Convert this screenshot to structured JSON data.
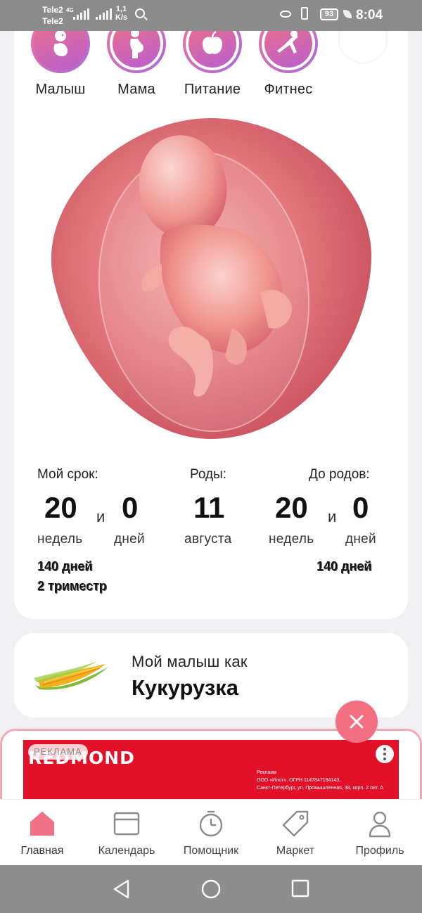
{
  "status_bar": {
    "carrier_1": "Tele2",
    "carrier_2": "Tele2",
    "network": "4G",
    "speed_value": "1,1",
    "speed_unit": "K/s",
    "battery": "93",
    "time": "8:04"
  },
  "categories": [
    {
      "label": "Малыш",
      "icon": "baby-icon"
    },
    {
      "label": "Мама",
      "icon": "pregnant-mother-icon"
    },
    {
      "label": "Питание",
      "icon": "apple-icon"
    },
    {
      "label": "Фитнес",
      "icon": "fitness-icon"
    },
    {
      "label": "",
      "icon": ""
    }
  ],
  "pregnancy": {
    "term_label": "Мой срок:",
    "term_weeks": "20",
    "term_days": "0",
    "and": "и",
    "weeks_unit": "недель",
    "days_unit": "дней",
    "birth_label": "Роды:",
    "birth_day": "11",
    "birth_month": "августа",
    "until_label": "До родов:",
    "until_weeks": "20",
    "until_days": "0",
    "term_total": "140 дней",
    "trimester": "2 триместр",
    "until_total": "140 дней"
  },
  "baby_size": {
    "prefix": "Мой малыш как",
    "name": "Кукурузка",
    "image": "corn-image"
  },
  "ad": {
    "tag": "РЕКЛАМА",
    "brand": "REDMOND",
    "legal_1": "Реклама",
    "legal_2": "ООО «Илот». ОГРН 1147847184143,",
    "legal_3": "Санкт-Петербург, ул. Промышленная, 38, корп. 2 лит. А"
  },
  "bottom_nav": [
    {
      "label": "Главная",
      "icon": "home-icon",
      "active": true
    },
    {
      "label": "Календарь",
      "icon": "calendar-icon",
      "active": false
    },
    {
      "label": "Помощник",
      "icon": "stopwatch-icon",
      "active": false
    },
    {
      "label": "Маркет",
      "icon": "tag-icon",
      "active": false
    },
    {
      "label": "Профиль",
      "icon": "profile-icon",
      "active": false
    }
  ],
  "colors": {
    "accent": "#f26f82",
    "ad_red": "#e3102a",
    "nav_active": "#f07085",
    "nav_inactive": "#8a8a8a"
  }
}
